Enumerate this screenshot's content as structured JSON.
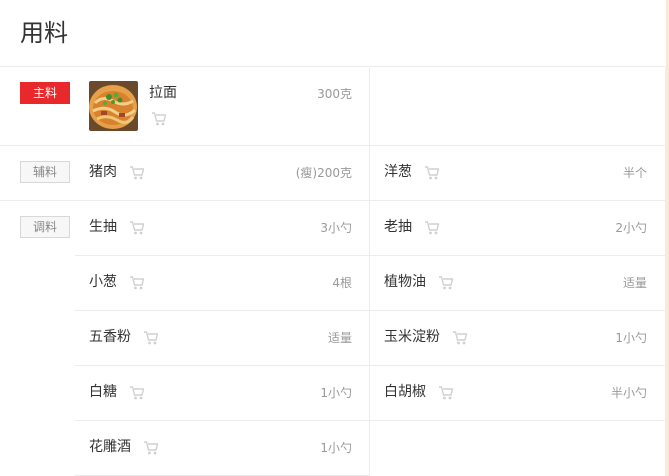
{
  "title": "用料",
  "sections": {
    "main_label": "主料",
    "aux_label": "辅料",
    "season_label": "调料"
  },
  "main": {
    "name": "拉面",
    "amount": "300克",
    "image": "noodle-thumbnail"
  },
  "aux": [
    {
      "name": "猪肉",
      "amount": "(瘦)200克"
    },
    {
      "name": "洋葱",
      "amount": "半个"
    }
  ],
  "seasoning": [
    {
      "name": "生抽",
      "amount": "3小勺"
    },
    {
      "name": "老抽",
      "amount": "2小勺"
    },
    {
      "name": "小葱",
      "amount": "4根"
    },
    {
      "name": "植物油",
      "amount": "适量"
    },
    {
      "name": "五香粉",
      "amount": "适量"
    },
    {
      "name": "玉米淀粉",
      "amount": "1小勺"
    },
    {
      "name": "白糖",
      "amount": "1小勺"
    },
    {
      "name": "白胡椒",
      "amount": "半小勺"
    },
    {
      "name": "花雕酒",
      "amount": "1小勺"
    }
  ],
  "icons": {
    "cart": "shopping-cart-icon"
  },
  "colors": {
    "main_tag": "#e8282b",
    "divider": "#ececec",
    "cart_icon": "#d0d0d0",
    "accent_strip": "#fbe9d6"
  }
}
